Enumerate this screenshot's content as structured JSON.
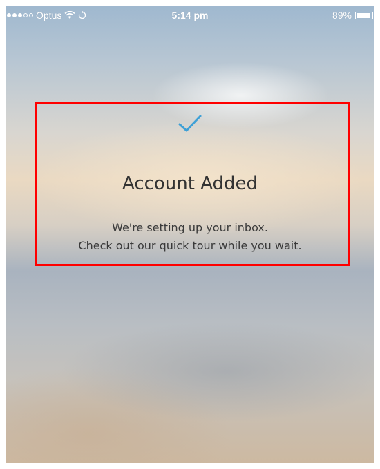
{
  "status_bar": {
    "carrier": "Optus",
    "time": "5:14 pm",
    "battery_text": "89%",
    "battery_level": 0.89,
    "signal_bars_filled": 3,
    "signal_bars_total": 5,
    "icons": [
      "wifi-icon",
      "loading-icon",
      "battery-icon"
    ]
  },
  "dialog": {
    "icon": "checkmark-icon",
    "title": "Account Added",
    "line1": "We're setting up your inbox.",
    "line2": "Check out our quick tour while you wait."
  },
  "colors": {
    "accent": "#3ea0d6",
    "highlight": "#ff0000",
    "text": "#333333"
  }
}
